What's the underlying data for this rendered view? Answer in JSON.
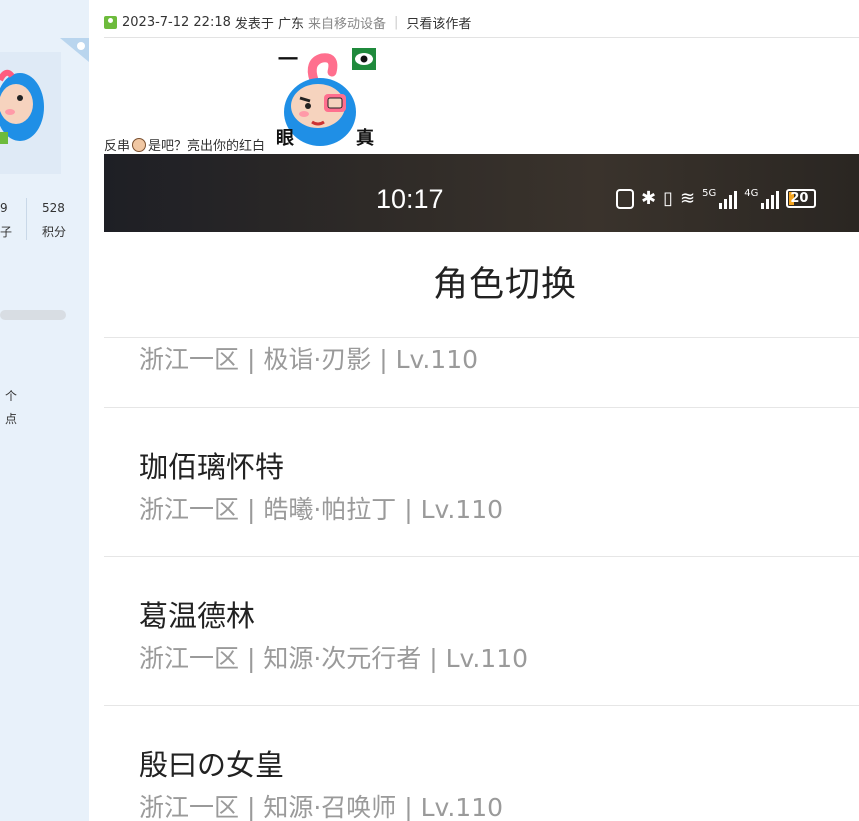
{
  "sidebar": {
    "stats": [
      {
        "value": "9",
        "label": "子"
      },
      {
        "value": "528",
        "label": "积分"
      }
    ],
    "chars": [
      "个",
      "点"
    ]
  },
  "post": {
    "timestamp": "2023-7-12 22:18",
    "posted_in": "发表于 广东",
    "source": "来自移动设备",
    "author_only": "只看该作者",
    "text_before": "反串",
    "text_after": "是吧？亮出你的红白",
    "sticker_text": [
      "一",
      "C",
      "眼",
      "真"
    ]
  },
  "screenshot": {
    "time": "10:17",
    "net_labels": [
      "5G",
      "4G"
    ],
    "battery": "20",
    "battery_level": 0.2,
    "title": "角色切换",
    "roles": [
      {
        "name": "",
        "info": "浙江一区 | 极诣·刃影 | Lv.110"
      },
      {
        "name": "珈佰璃怀特",
        "info": "浙江一区 | 皓曦·帕拉丁 | Lv.110"
      },
      {
        "name": "葛温德林",
        "info": "浙江一区 | 知源·次元行者 | Lv.110"
      },
      {
        "name": "殷曰の女皇",
        "info": "浙江一区 | 知源·召唤师 | Lv.110"
      }
    ]
  },
  "colors": {
    "sidebar_bg": "#e8f1fa",
    "sticker_blue": "#1f8fe6",
    "sticker_pink": "#ff6f8e",
    "title_text": "#222222",
    "subtext": "#9a9a9a"
  }
}
